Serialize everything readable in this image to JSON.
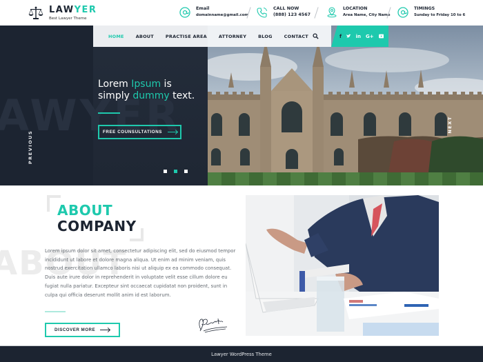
{
  "header": {
    "logo": {
      "title_main": "LAW",
      "title_accent": "YER",
      "subtitle": "Best Lawyer Theme",
      "icon": "scales-icon"
    },
    "contacts": [
      {
        "icon": "at-sign-icon",
        "label": "Email",
        "value": "domainname@gmail.com"
      },
      {
        "icon": "phone-icon",
        "label": "CALL NOW",
        "value": "(888) 123 4567"
      },
      {
        "icon": "location-pin-icon",
        "label": "LOCATION",
        "value": "Area Name, City Name"
      },
      {
        "icon": "at-sign-icon",
        "label": "TIMINGS",
        "value": "Sunday to Friday 10 to 6"
      }
    ]
  },
  "nav": {
    "items": [
      {
        "label": "HOME",
        "active": true
      },
      {
        "label": "ABOUT",
        "active": false
      },
      {
        "label": "PRACTISE AREA",
        "active": false
      },
      {
        "label": "ATTORNEY",
        "active": false
      },
      {
        "label": "BLOG",
        "active": false
      },
      {
        "label": "CONTACT",
        "active": false
      }
    ],
    "search_icon": "search-icon",
    "social": [
      {
        "icon": "facebook-icon",
        "glyph": "f"
      },
      {
        "icon": "twitter-icon",
        "glyph": "t"
      },
      {
        "icon": "linkedin-icon",
        "glyph": "in"
      },
      {
        "icon": "google-plus-icon",
        "glyph": "G+"
      },
      {
        "icon": "youtube-icon",
        "glyph": "yt"
      }
    ]
  },
  "hero": {
    "watermark": "AWYER",
    "heading": {
      "part1": "Lorem ",
      "accent1": "Ipsum",
      "part2": " is",
      "part3": "simply ",
      "accent2": "dummy",
      "part4": " text."
    },
    "button_label": "FREE COUNSULTATIONS",
    "prev_label": "PREVIOUS",
    "next_label": "NEXT",
    "slides_total": 3,
    "active_slide": 2,
    "image_description": "gothic college building with lawn"
  },
  "about": {
    "watermark": "ABOUT",
    "title_accent": "ABOUT",
    "title_main": "COMPANY",
    "body": "Lorem ipsum dolor sit amet, consectetur adipiscing elit, sed do eiusmod tempor incididunt ut labore et dolore magna aliqua. Ut enim ad minim veniam, quis nostrud exercitation ullamco laboris nisi ut aliquip ex ea commodo consequat. Duis aute irure dolor in reprehenderit in voluptate velit esse cillum dolore eu fugiat nulla pariatur. Excepteur sint occaecat cupidatat non proident, sunt in culpa qui officia deserunt mollit anim id est laborum.",
    "button_label": "DISCOVER MORE",
    "image_description": "lawyer in suit at desk with laptop"
  },
  "footer": {
    "text": "Lawyer WordPress Theme"
  },
  "colors": {
    "accent": "#1ec9ad",
    "dark": "#1c2431"
  }
}
